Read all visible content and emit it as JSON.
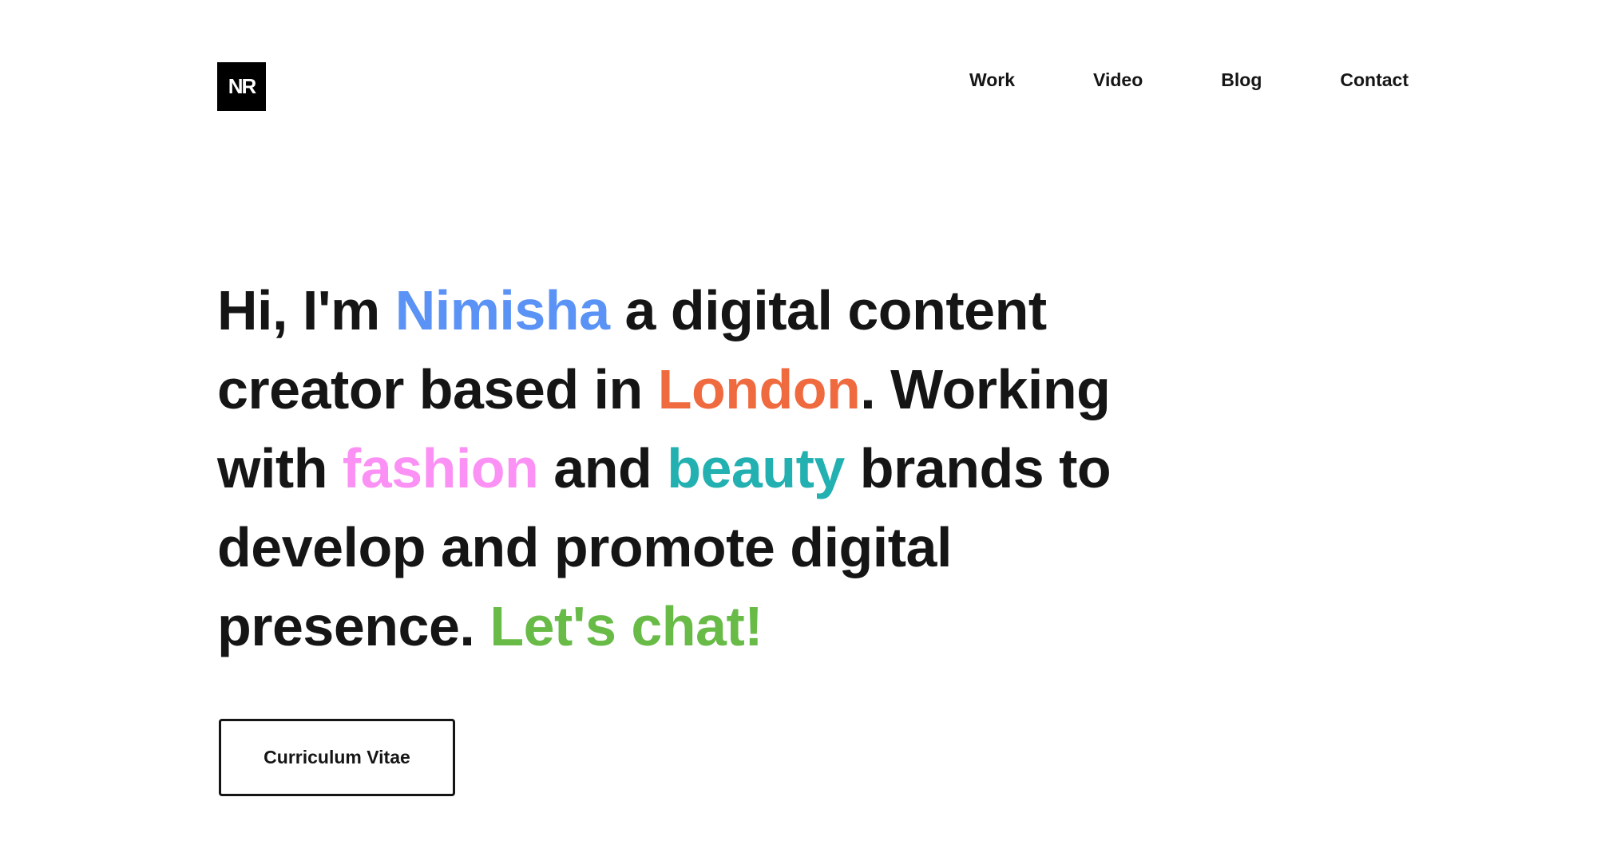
{
  "logo": {
    "text": "NR"
  },
  "nav": {
    "items": [
      {
        "label": "Work"
      },
      {
        "label": "Video"
      },
      {
        "label": "Blog"
      },
      {
        "label": "Contact"
      }
    ]
  },
  "hero": {
    "segments": [
      {
        "text": "Hi, I'm ",
        "color": "#151515"
      },
      {
        "text": "Nimisha",
        "color": "#5a92f5"
      },
      {
        "text": " a digital content creator based in ",
        "color": "#151515"
      },
      {
        "text": "London",
        "color": "#f06a3f"
      },
      {
        "text": ". Working with ",
        "color": "#151515"
      },
      {
        "text": "fashion",
        "color": "#fb91f4"
      },
      {
        "text": " and ",
        "color": "#151515"
      },
      {
        "text": "beauty",
        "color": "#23b0b1"
      },
      {
        "text": " brands to develop and promote digital presence. ",
        "color": "#151515"
      },
      {
        "text": "Let's chat!",
        "color": "#69bb48"
      }
    ]
  },
  "cv_button": {
    "label": "Curriculum Vitae"
  },
  "colors": {
    "text": "#151515",
    "background": "#ffffff",
    "logo_bg": "#000000",
    "accent_blue": "#5a92f5",
    "accent_orange": "#f06a3f",
    "accent_pink": "#fb91f4",
    "accent_teal": "#23b0b1",
    "accent_green": "#69bb48"
  }
}
